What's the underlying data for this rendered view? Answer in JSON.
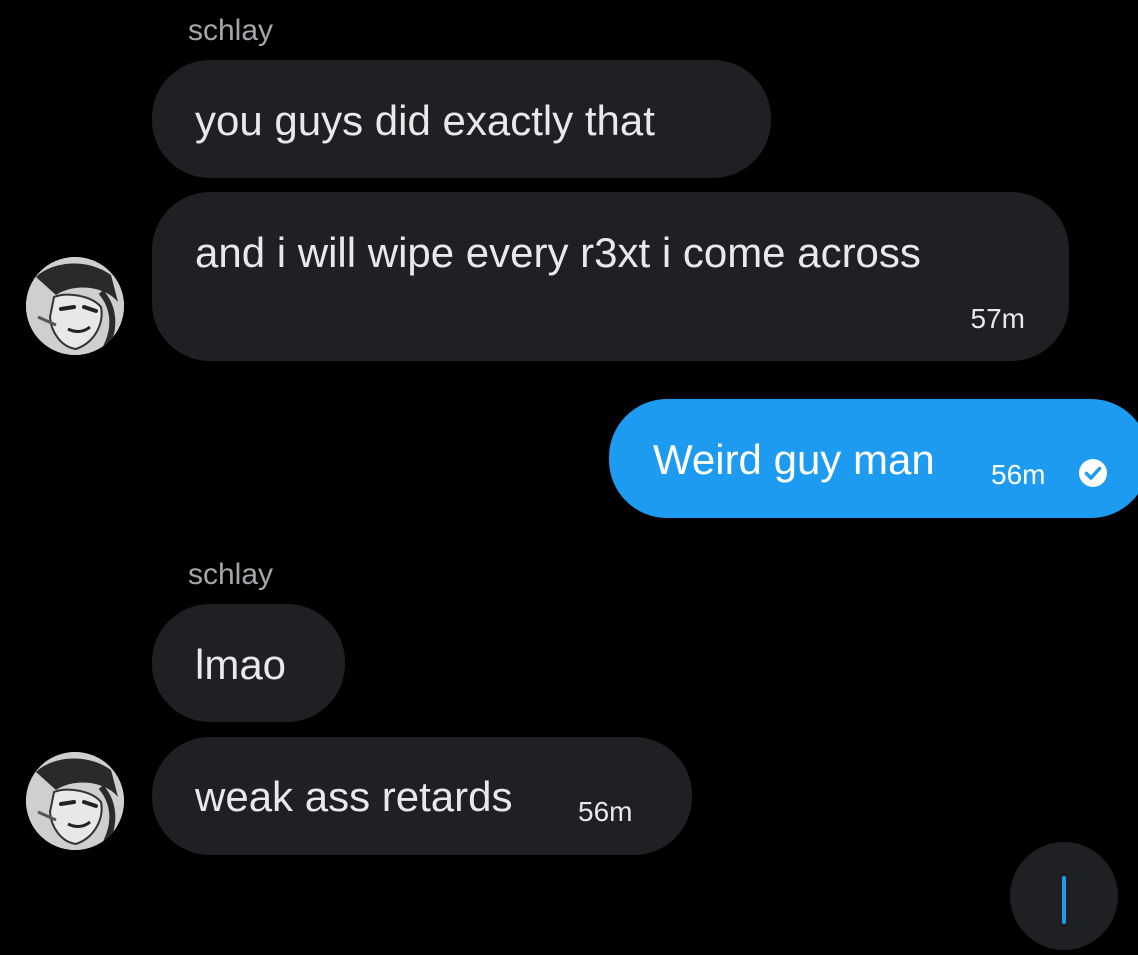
{
  "colors": {
    "background": "#000000",
    "received_bubble": "#1e2024",
    "sent_bubble": "#1d9bf0",
    "sender_name": "#a3a7ab",
    "text": "#e7e9ea"
  },
  "messages": [
    {
      "sender": "schlay",
      "text": "you guys did exactly that"
    },
    {
      "text": "and i will wipe every r3xt i come across",
      "time": "57m"
    },
    {
      "text": "Weird guy man",
      "time": "56m",
      "status_icon": "check-circle-icon"
    },
    {
      "sender": "schlay",
      "text": "lmao"
    },
    {
      "text": "weak ass retards",
      "time": "56m"
    }
  ]
}
